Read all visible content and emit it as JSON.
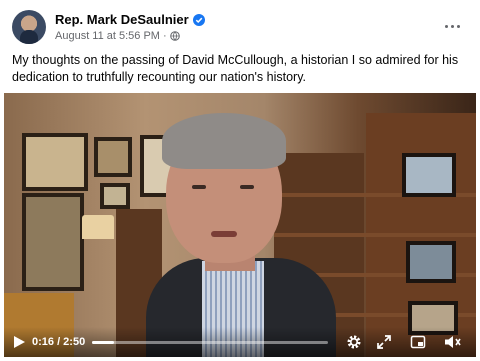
{
  "post": {
    "author": "Rep. Mark DeSaulnier",
    "timestamp": "August 11 at 5:56 PM",
    "separator": "·",
    "text": "My thoughts on the passing of David McCullough, a historian I so admired for his dedication to truthfully recounting our nation's history."
  },
  "icons": {
    "verified": "verified-badge-icon",
    "audience": "globe-icon",
    "more": "more-options-icon"
  },
  "video": {
    "current_time": "0:16",
    "duration": "2:50",
    "time_display": "0:16 / 2:50",
    "progress_fraction": 0.094
  },
  "colors": {
    "verified_blue": "#1877f2",
    "secondary_text": "#65676b"
  }
}
